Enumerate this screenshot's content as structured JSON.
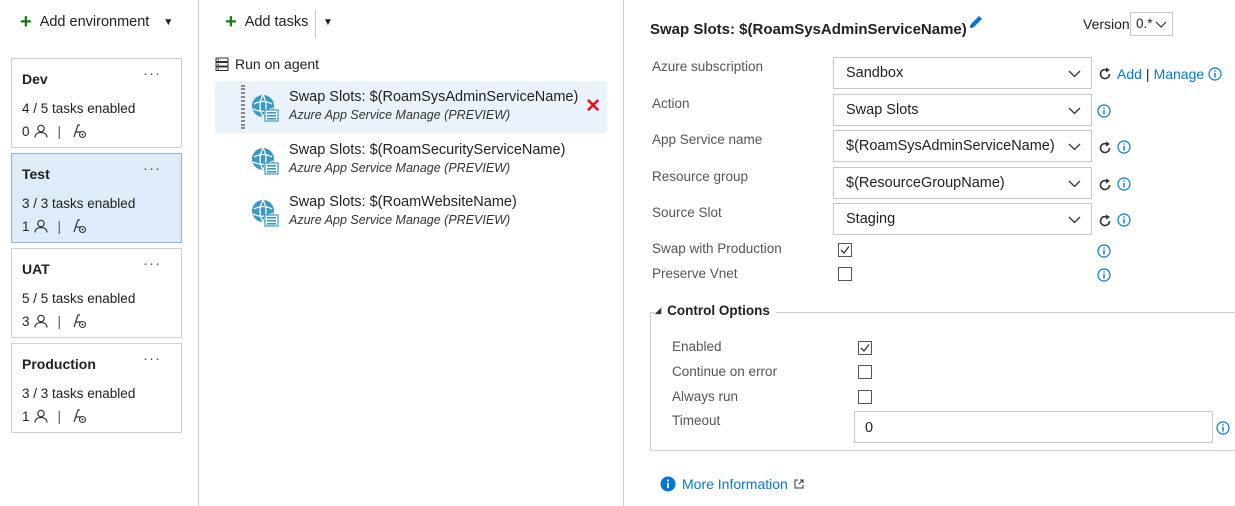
{
  "environments_panel": {
    "add_label": "Add environment",
    "environments": [
      {
        "name": "Dev",
        "tasks": "4 / 5 tasks enabled",
        "approvers": "0",
        "selected": false
      },
      {
        "name": "Test",
        "tasks": "3 / 3 tasks enabled",
        "approvers": "1",
        "selected": true
      },
      {
        "name": "UAT",
        "tasks": "5 / 5 tasks enabled",
        "approvers": "3",
        "selected": false
      },
      {
        "name": "Production",
        "tasks": "3 / 3 tasks enabled",
        "approvers": "1",
        "selected": false
      }
    ],
    "more_glyph": "···",
    "separator": "|"
  },
  "tasks_panel": {
    "add_label": "Add tasks",
    "agent_label": "Run on agent",
    "tasks": [
      {
        "title": "Swap Slots: $(RoamSysAdminServiceName)",
        "subtitle": "Azure App Service Manage (PREVIEW)",
        "selected": true
      },
      {
        "title": "Swap Slots: $(RoamSecurityServiceName)",
        "subtitle": "Azure App Service Manage (PREVIEW)",
        "selected": false
      },
      {
        "title": "Swap Slots: $(RoamWebsiteName)",
        "subtitle": "Azure App Service Manage (PREVIEW)",
        "selected": false
      }
    ],
    "delete_glyph": "✕"
  },
  "details": {
    "title": "Swap Slots: $(RoamSysAdminServiceName)",
    "version_label": "Version",
    "version_value": "0.*",
    "fields": {
      "azure_subscription": {
        "label": "Azure subscription",
        "value": "Sandbox"
      },
      "action": {
        "label": "Action",
        "value": "Swap Slots"
      },
      "app_service_name": {
        "label": "App Service name",
        "value": "$(RoamSysAdminServiceName)"
      },
      "resource_group": {
        "label": "Resource group",
        "value": "$(ResourceGroupName)"
      },
      "source_slot": {
        "label": "Source Slot",
        "value": "Staging"
      },
      "swap_with_production": {
        "label": "Swap with Production",
        "checked": true
      },
      "preserve_vnet": {
        "label": "Preserve Vnet",
        "checked": false
      }
    },
    "add_link": "Add",
    "link_separator": "|",
    "manage_link": "Manage",
    "control_options": {
      "header": "Control Options",
      "enabled": {
        "label": "Enabled",
        "checked": true
      },
      "continue_on_error": {
        "label": "Continue on error",
        "checked": false
      },
      "always_run": {
        "label": "Always run",
        "checked": false
      },
      "timeout": {
        "label": "Timeout",
        "value": "0"
      }
    },
    "more_information": "More Information"
  },
  "colors": {
    "accent": "#0078d7",
    "add_green": "#107c10",
    "delete_red": "#e81123",
    "selected_bg": "#deecf9"
  }
}
